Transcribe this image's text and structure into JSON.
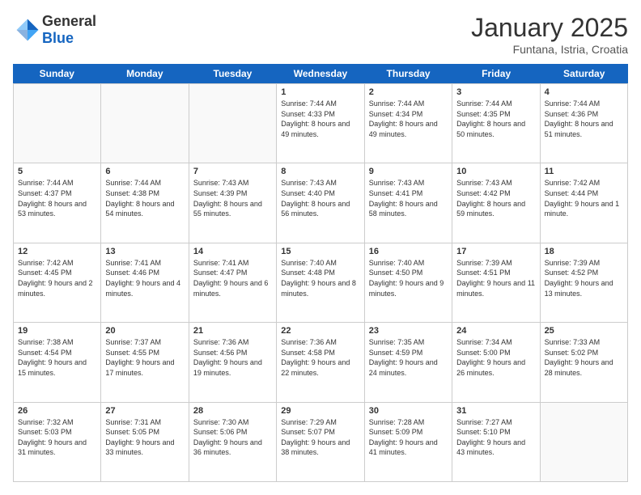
{
  "header": {
    "logo": {
      "general": "General",
      "blue": "Blue"
    },
    "title": "January 2025",
    "subtitle": "Funtana, Istria, Croatia"
  },
  "weekdays": [
    "Sunday",
    "Monday",
    "Tuesday",
    "Wednesday",
    "Thursday",
    "Friday",
    "Saturday"
  ],
  "weeks": [
    [
      {
        "day": "",
        "empty": true
      },
      {
        "day": "",
        "empty": true
      },
      {
        "day": "",
        "empty": true
      },
      {
        "day": "1",
        "sunrise": "Sunrise: 7:44 AM",
        "sunset": "Sunset: 4:33 PM",
        "daylight": "Daylight: 8 hours and 49 minutes."
      },
      {
        "day": "2",
        "sunrise": "Sunrise: 7:44 AM",
        "sunset": "Sunset: 4:34 PM",
        "daylight": "Daylight: 8 hours and 49 minutes."
      },
      {
        "day": "3",
        "sunrise": "Sunrise: 7:44 AM",
        "sunset": "Sunset: 4:35 PM",
        "daylight": "Daylight: 8 hours and 50 minutes."
      },
      {
        "day": "4",
        "sunrise": "Sunrise: 7:44 AM",
        "sunset": "Sunset: 4:36 PM",
        "daylight": "Daylight: 8 hours and 51 minutes."
      }
    ],
    [
      {
        "day": "5",
        "sunrise": "Sunrise: 7:44 AM",
        "sunset": "Sunset: 4:37 PM",
        "daylight": "Daylight: 8 hours and 53 minutes."
      },
      {
        "day": "6",
        "sunrise": "Sunrise: 7:44 AM",
        "sunset": "Sunset: 4:38 PM",
        "daylight": "Daylight: 8 hours and 54 minutes."
      },
      {
        "day": "7",
        "sunrise": "Sunrise: 7:43 AM",
        "sunset": "Sunset: 4:39 PM",
        "daylight": "Daylight: 8 hours and 55 minutes."
      },
      {
        "day": "8",
        "sunrise": "Sunrise: 7:43 AM",
        "sunset": "Sunset: 4:40 PM",
        "daylight": "Daylight: 8 hours and 56 minutes."
      },
      {
        "day": "9",
        "sunrise": "Sunrise: 7:43 AM",
        "sunset": "Sunset: 4:41 PM",
        "daylight": "Daylight: 8 hours and 58 minutes."
      },
      {
        "day": "10",
        "sunrise": "Sunrise: 7:43 AM",
        "sunset": "Sunset: 4:42 PM",
        "daylight": "Daylight: 8 hours and 59 minutes."
      },
      {
        "day": "11",
        "sunrise": "Sunrise: 7:42 AM",
        "sunset": "Sunset: 4:44 PM",
        "daylight": "Daylight: 9 hours and 1 minute."
      }
    ],
    [
      {
        "day": "12",
        "sunrise": "Sunrise: 7:42 AM",
        "sunset": "Sunset: 4:45 PM",
        "daylight": "Daylight: 9 hours and 2 minutes."
      },
      {
        "day": "13",
        "sunrise": "Sunrise: 7:41 AM",
        "sunset": "Sunset: 4:46 PM",
        "daylight": "Daylight: 9 hours and 4 minutes."
      },
      {
        "day": "14",
        "sunrise": "Sunrise: 7:41 AM",
        "sunset": "Sunset: 4:47 PM",
        "daylight": "Daylight: 9 hours and 6 minutes."
      },
      {
        "day": "15",
        "sunrise": "Sunrise: 7:40 AM",
        "sunset": "Sunset: 4:48 PM",
        "daylight": "Daylight: 9 hours and 8 minutes."
      },
      {
        "day": "16",
        "sunrise": "Sunrise: 7:40 AM",
        "sunset": "Sunset: 4:50 PM",
        "daylight": "Daylight: 9 hours and 9 minutes."
      },
      {
        "day": "17",
        "sunrise": "Sunrise: 7:39 AM",
        "sunset": "Sunset: 4:51 PM",
        "daylight": "Daylight: 9 hours and 11 minutes."
      },
      {
        "day": "18",
        "sunrise": "Sunrise: 7:39 AM",
        "sunset": "Sunset: 4:52 PM",
        "daylight": "Daylight: 9 hours and 13 minutes."
      }
    ],
    [
      {
        "day": "19",
        "sunrise": "Sunrise: 7:38 AM",
        "sunset": "Sunset: 4:54 PM",
        "daylight": "Daylight: 9 hours and 15 minutes."
      },
      {
        "day": "20",
        "sunrise": "Sunrise: 7:37 AM",
        "sunset": "Sunset: 4:55 PM",
        "daylight": "Daylight: 9 hours and 17 minutes."
      },
      {
        "day": "21",
        "sunrise": "Sunrise: 7:36 AM",
        "sunset": "Sunset: 4:56 PM",
        "daylight": "Daylight: 9 hours and 19 minutes."
      },
      {
        "day": "22",
        "sunrise": "Sunrise: 7:36 AM",
        "sunset": "Sunset: 4:58 PM",
        "daylight": "Daylight: 9 hours and 22 minutes."
      },
      {
        "day": "23",
        "sunrise": "Sunrise: 7:35 AM",
        "sunset": "Sunset: 4:59 PM",
        "daylight": "Daylight: 9 hours and 24 minutes."
      },
      {
        "day": "24",
        "sunrise": "Sunrise: 7:34 AM",
        "sunset": "Sunset: 5:00 PM",
        "daylight": "Daylight: 9 hours and 26 minutes."
      },
      {
        "day": "25",
        "sunrise": "Sunrise: 7:33 AM",
        "sunset": "Sunset: 5:02 PM",
        "daylight": "Daylight: 9 hours and 28 minutes."
      }
    ],
    [
      {
        "day": "26",
        "sunrise": "Sunrise: 7:32 AM",
        "sunset": "Sunset: 5:03 PM",
        "daylight": "Daylight: 9 hours and 31 minutes."
      },
      {
        "day": "27",
        "sunrise": "Sunrise: 7:31 AM",
        "sunset": "Sunset: 5:05 PM",
        "daylight": "Daylight: 9 hours and 33 minutes."
      },
      {
        "day": "28",
        "sunrise": "Sunrise: 7:30 AM",
        "sunset": "Sunset: 5:06 PM",
        "daylight": "Daylight: 9 hours and 36 minutes."
      },
      {
        "day": "29",
        "sunrise": "Sunrise: 7:29 AM",
        "sunset": "Sunset: 5:07 PM",
        "daylight": "Daylight: 9 hours and 38 minutes."
      },
      {
        "day": "30",
        "sunrise": "Sunrise: 7:28 AM",
        "sunset": "Sunset: 5:09 PM",
        "daylight": "Daylight: 9 hours and 41 minutes."
      },
      {
        "day": "31",
        "sunrise": "Sunrise: 7:27 AM",
        "sunset": "Sunset: 5:10 PM",
        "daylight": "Daylight: 9 hours and 43 minutes."
      },
      {
        "day": "",
        "empty": true
      }
    ]
  ]
}
